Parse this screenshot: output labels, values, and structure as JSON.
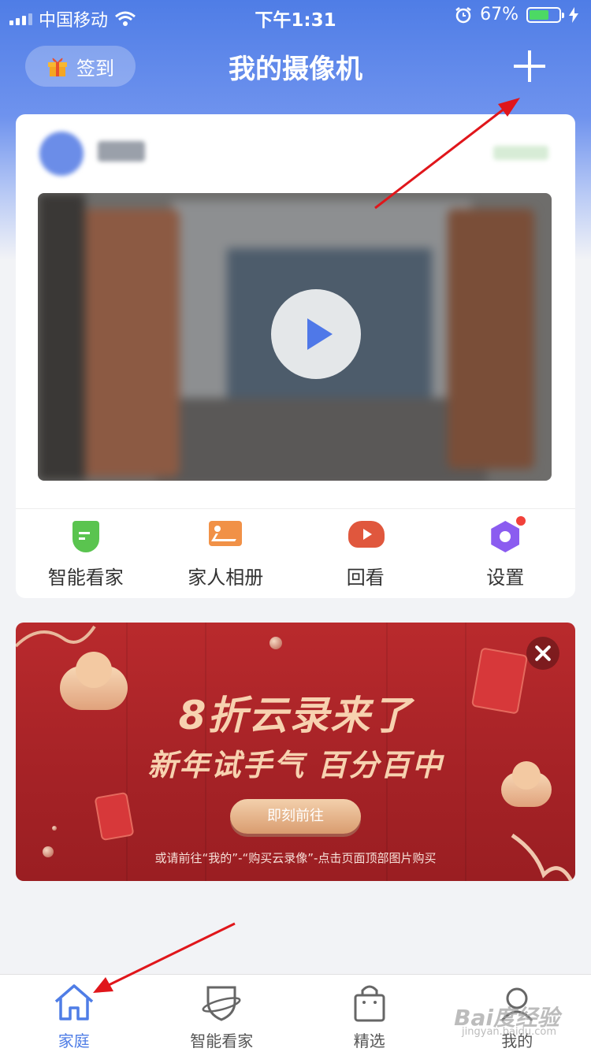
{
  "status_bar": {
    "carrier": "中国移动",
    "time": "下午1:31",
    "battery_percent": "67%",
    "battery_level": 0.67
  },
  "nav": {
    "checkin_label": "签到",
    "title": "我的摄像机"
  },
  "camera_card": {
    "quick_actions": [
      {
        "label": "智能看家",
        "icon": "shield-icon"
      },
      {
        "label": "家人相册",
        "icon": "album-icon"
      },
      {
        "label": "回看",
        "icon": "replay-icon"
      },
      {
        "label": "设置",
        "icon": "settings-icon"
      }
    ]
  },
  "promo": {
    "title": "8折云录来了",
    "subtitle": "新年试手气 百分百中",
    "cta": "即刻前往",
    "note": "或请前往“我的”-“购买云录像”-点击页面顶部图片购买"
  },
  "tabbar": {
    "items": [
      {
        "label": "家庭",
        "icon": "home-icon",
        "active": true
      },
      {
        "label": "智能看家",
        "icon": "shield-outline-icon",
        "active": false
      },
      {
        "label": "精选",
        "icon": "shopping-bag-icon",
        "active": false
      },
      {
        "label": "我的",
        "icon": "profile-icon",
        "active": false
      }
    ]
  },
  "watermark": {
    "text": "Bai度经验",
    "sub": "jingyan.baidu.com"
  },
  "colors": {
    "accent": "#4f7de6",
    "promo_bg": "#a52226",
    "annotation_arrow": "#e0161b"
  }
}
